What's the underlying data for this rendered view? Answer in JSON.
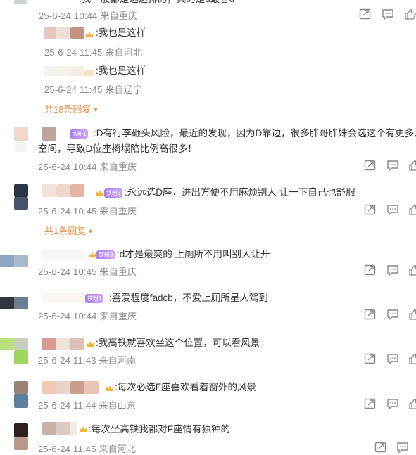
{
  "top_partial": {
    "text_partial": ":我一般都是选这排的，真的是d最香d",
    "meta": "25-6-24 10:44 来自重庆"
  },
  "replies": [
    {
      "text": ":我也是这样",
      "meta": "25-6-24 11:45 来自河北"
    },
    {
      "text": ":我也是这样",
      "meta": "25-6-24 11:45 来自辽宁"
    }
  ],
  "more_replies_1": "共18条回复",
  "comments": [
    {
      "badge": "铁粉1",
      "line1": ":D有行李砸头风险，最近的发现，因为D靠边，很多胖哥胖妹会选这个有更多活",
      "line2": "空间，导致D位座椅塌陷比例高很多！",
      "meta": "25-6-24 10:44 来自重庆"
    },
    {
      "badge": "铁粉3",
      "line1": ":永远选D座，进出方便不用麻烦别人 让一下自己也舒服",
      "meta": "25-6-24 10:45 来自重庆"
    },
    {
      "badge": "铁粉3",
      "line1": ":d才是最爽的 上厕所不用叫别人让开",
      "meta": "25-6-24 10:45 来自重庆"
    },
    {
      "badge": "铁粉1",
      "line1": ":喜爱程度fadcb，不爱上厕所星人驾到",
      "meta": "25-6-24 10:44 来自重庆"
    },
    {
      "line1": ":我高铁就喜欢坐这个位置，可以看风景",
      "meta": "25-6-24 11:43 来自河南"
    },
    {
      "line1": ":每次必选F座喜欢看着窗外的风景",
      "meta": "25-6-24 11:44 来自山东"
    },
    {
      "line1": ":每次坐高铁我都对F座情有独钟的",
      "meta": "25-6-24 11:45 来自河北"
    }
  ],
  "more_replies_2": "共1条回复",
  "icons": [
    "share-icon",
    "comment-icon",
    "like-icon"
  ]
}
